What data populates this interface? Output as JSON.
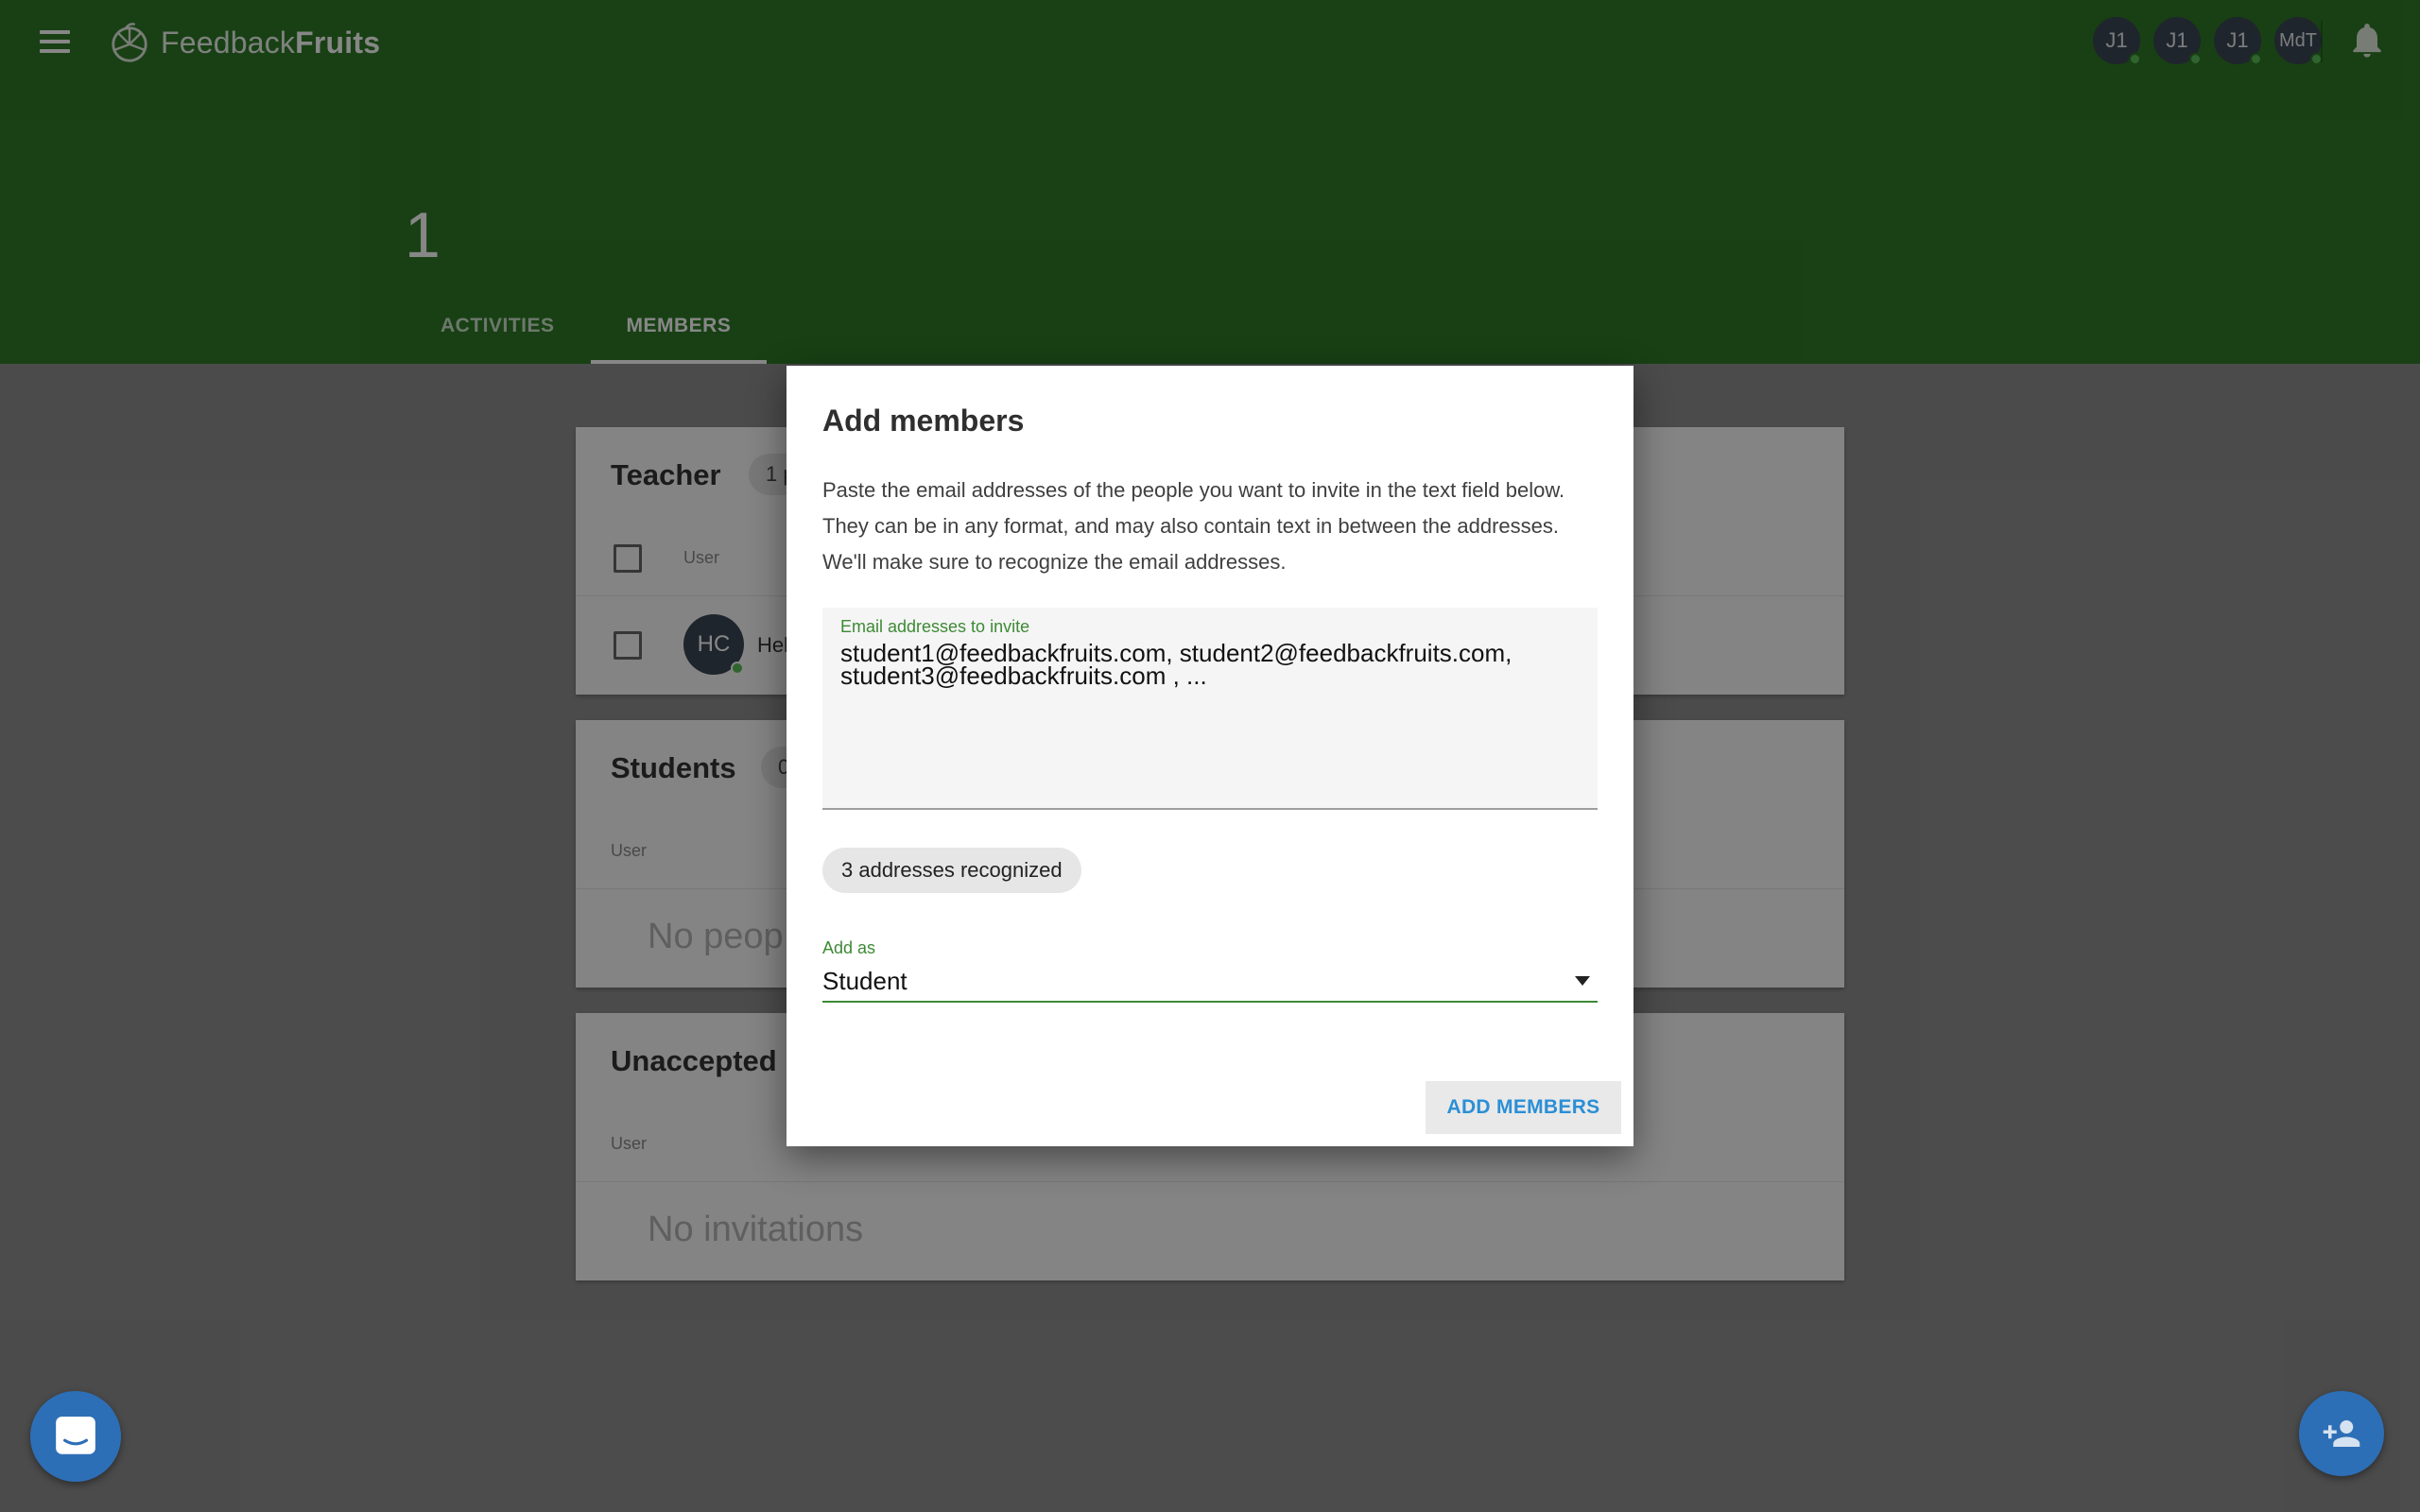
{
  "app": {
    "logo_light": "Feedback",
    "logo_bold": "Fruits"
  },
  "header": {
    "avatars": [
      {
        "initials": "J1"
      },
      {
        "initials": "J1"
      },
      {
        "initials": "J1"
      },
      {
        "initials": "MdT"
      }
    ],
    "course_title": "1",
    "tabs": [
      {
        "label": "ACTIVITIES",
        "active": false
      },
      {
        "label": "MEMBERS",
        "active": true
      }
    ]
  },
  "sections": {
    "teacher": {
      "title": "Teacher",
      "count": "1 p",
      "user_col": "User",
      "rows": [
        {
          "initials": "HC",
          "name": "Hel"
        }
      ]
    },
    "students": {
      "title": "Students",
      "count": "0",
      "user_col": "User",
      "empty": "No peop"
    },
    "unaccepted": {
      "title": "Unaccepted",
      "user_col": "User",
      "empty": "No invitations"
    }
  },
  "modal": {
    "title": "Add members",
    "description": "Paste the email addresses of the people you want to invite in the text field below. They can be in any format, and may also contain text in between the addresses. We'll make sure to recognize the email addresses.",
    "textarea": {
      "label": "Email addresses to invite",
      "value": "student1@feedbackfruits.com, student2@feedbackfruits.com, student3@feedbackfruits.com , ..."
    },
    "recognized": "3 addresses recognized",
    "add_as": {
      "label": "Add as",
      "value": "Student"
    },
    "submit": "ADD MEMBERS"
  },
  "colors": {
    "header_green": "#2f7a27",
    "accent_green": "#3d8a35",
    "fab_blue": "#2d6fb6",
    "button_text_blue": "#2b8fd6"
  },
  "icons": {
    "menu": "menu-icon",
    "logo": "feedbackfruits-logo-icon",
    "notifications": "bell-icon",
    "chat": "chat-icon",
    "add_person": "person-add-icon",
    "dropdown": "caret-down-icon"
  }
}
